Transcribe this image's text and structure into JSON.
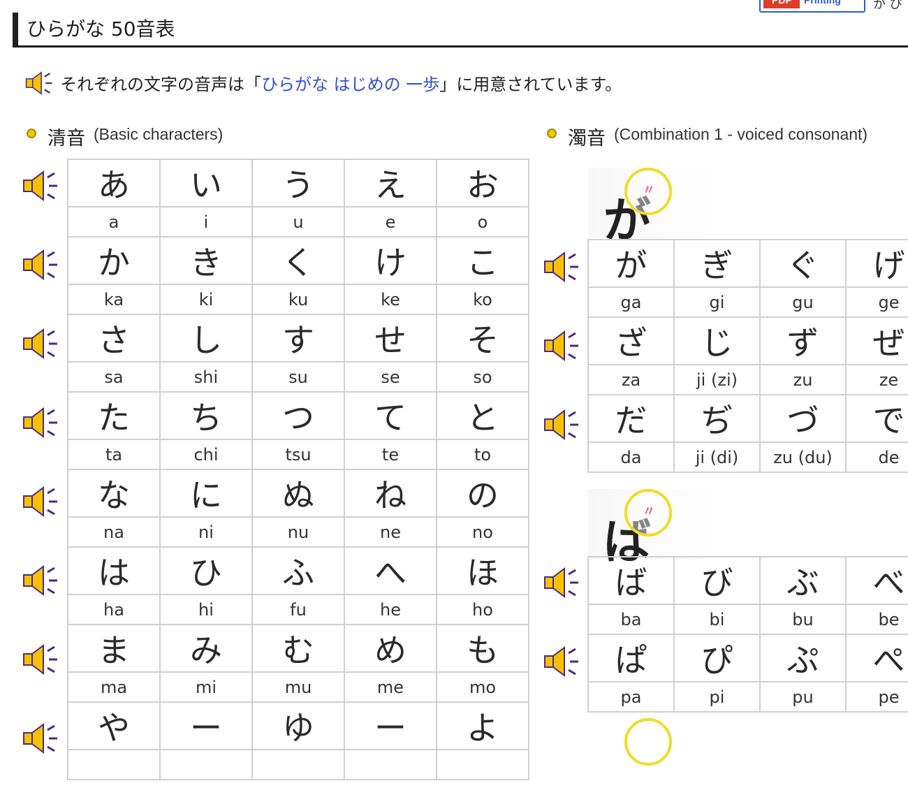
{
  "toolbar": {
    "pdf_badge": "PDF",
    "pdf_label": "Printing",
    "extra_text": "か ぴ"
  },
  "page": {
    "title": "ひらがな 50音表",
    "note_pre": "それぞれの文字の音声は「",
    "note_link": "ひらがな はじめの 一歩",
    "note_post": "」に用意されています。"
  },
  "seion": {
    "title_jp": "清音",
    "title_en": "(Basic characters)",
    "rows": [
      {
        "kana": [
          "あ",
          "い",
          "う",
          "え",
          "お"
        ],
        "romaji": [
          "a",
          "i",
          "u",
          "e",
          "o"
        ]
      },
      {
        "kana": [
          "か",
          "き",
          "く",
          "け",
          "こ"
        ],
        "romaji": [
          "ka",
          "ki",
          "ku",
          "ke",
          "ko"
        ]
      },
      {
        "kana": [
          "さ",
          "し",
          "す",
          "せ",
          "そ"
        ],
        "romaji": [
          "sa",
          "shi",
          "su",
          "se",
          "so"
        ]
      },
      {
        "kana": [
          "た",
          "ち",
          "つ",
          "て",
          "と"
        ],
        "romaji": [
          "ta",
          "chi",
          "tsu",
          "te",
          "to"
        ]
      },
      {
        "kana": [
          "な",
          "に",
          "ぬ",
          "ね",
          "の"
        ],
        "romaji": [
          "na",
          "ni",
          "nu",
          "ne",
          "no"
        ]
      },
      {
        "kana": [
          "は",
          "ひ",
          "ふ",
          "へ",
          "ほ"
        ],
        "romaji": [
          "ha",
          "hi",
          "fu",
          "he",
          "ho"
        ]
      },
      {
        "kana": [
          "ま",
          "み",
          "む",
          "め",
          "も"
        ],
        "romaji": [
          "ma",
          "mi",
          "mu",
          "me",
          "mo"
        ]
      },
      {
        "kana": [
          "や",
          "ー",
          "ゆ",
          "ー",
          "よ"
        ],
        "romaji": [
          "",
          "",
          "",
          "",
          ""
        ]
      }
    ]
  },
  "dakuon": {
    "title_jp": "濁音",
    "title_en": "(Combination 1 - voiced consonant)",
    "hints": [
      "が",
      "ば"
    ],
    "group1": [
      {
        "kana": [
          "が",
          "ぎ",
          "ぐ",
          "げ"
        ],
        "romaji": [
          "ga",
          "gi",
          "gu",
          "ge"
        ]
      },
      {
        "kana": [
          "ざ",
          "じ",
          "ず",
          "ぜ"
        ],
        "romaji": [
          "za",
          "ji (zi)",
          "zu",
          "ze"
        ]
      },
      {
        "kana": [
          "だ",
          "ぢ",
          "づ",
          "で"
        ],
        "romaji": [
          "da",
          "ji (di)",
          "zu (du)",
          "de"
        ]
      }
    ],
    "group2": [
      {
        "kana": [
          "ば",
          "び",
          "ぶ",
          "べ"
        ],
        "romaji": [
          "ba",
          "bi",
          "bu",
          "be"
        ]
      },
      {
        "kana": [
          "ぱ",
          "ぴ",
          "ぷ",
          "ぺ"
        ],
        "romaji": [
          "pa",
          "pi",
          "pu",
          "pe"
        ]
      }
    ]
  }
}
